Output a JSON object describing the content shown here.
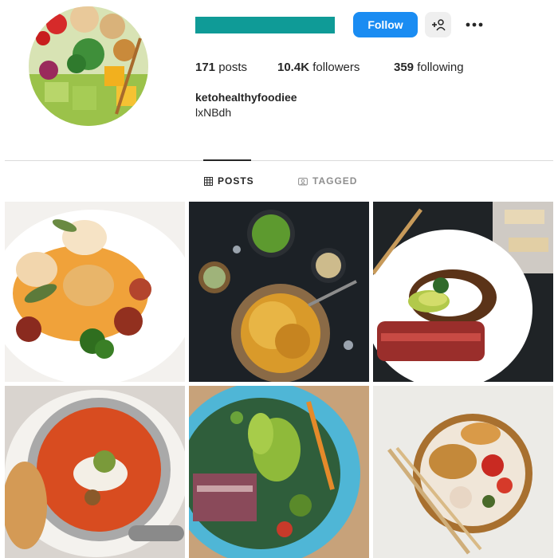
{
  "profile": {
    "follow_label": "Follow",
    "username_bar_color": "#0f9b97",
    "follow_color": "#1a8cf2",
    "stats": {
      "posts_count": "171",
      "posts_label": "posts",
      "followers_count": "10.4K",
      "followers_label": "followers",
      "following_count": "359",
      "following_label": "following"
    },
    "full_name": "ketohealthyfoodiee",
    "bio": "lxNBdh"
  },
  "tabs": [
    {
      "label": "POSTS",
      "icon": "grid-icon",
      "active": true
    },
    {
      "label": "TAGGED",
      "icon": "tag-icon",
      "active": false
    }
  ],
  "posts": [
    {
      "dish": "seared scallops"
    },
    {
      "dish": "noodles with matcha"
    },
    {
      "dish": "seared tuna with avocado"
    },
    {
      "dish": "tomato soup"
    },
    {
      "dish": "poke bowl"
    },
    {
      "dish": "chicken noodle bowl"
    }
  ]
}
